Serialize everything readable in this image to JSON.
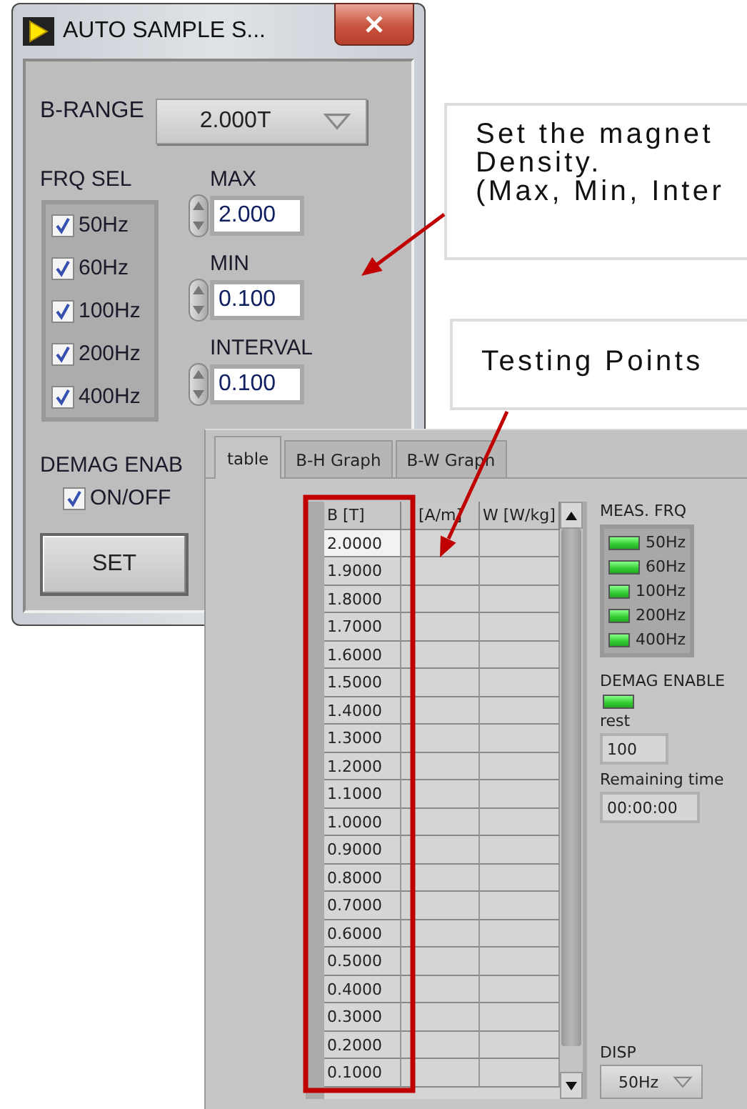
{
  "settings_window": {
    "title": "AUTO SAMPLE S...",
    "b_range": {
      "label": "B-RANGE",
      "value": "2.000T"
    },
    "frq_sel": {
      "label": "FRQ SEL",
      "options": [
        {
          "label": "50Hz",
          "checked": true
        },
        {
          "label": "60Hz",
          "checked": true
        },
        {
          "label": "100Hz",
          "checked": true
        },
        {
          "label": "200Hz",
          "checked": true
        },
        {
          "label": "400Hz",
          "checked": true
        }
      ]
    },
    "numerics": [
      {
        "label": "MAX",
        "value": "2.000"
      },
      {
        "label": "MIN",
        "value": "0.100"
      },
      {
        "label": "INTERVAL",
        "value": "0.100"
      }
    ],
    "demag": {
      "label": "DEMAG ENAB",
      "option": {
        "label": "ON/OFF",
        "checked": true
      }
    },
    "set_button": "SET"
  },
  "results_window": {
    "tabs": [
      {
        "label": "table",
        "selected": true
      },
      {
        "label": "B-H Graph",
        "selected": false
      },
      {
        "label": "B-W Graph",
        "selected": false
      }
    ],
    "table": {
      "columns": [
        "B [T]",
        "[A/m]",
        "W [W/kg]"
      ],
      "rows": [
        "2.0000",
        "1.9000",
        "1.8000",
        "1.7000",
        "1.6000",
        "1.5000",
        "1.4000",
        "1.3000",
        "1.2000",
        "1.1000",
        "1.0000",
        "0.9000",
        "0.8000",
        "0.7000",
        "0.6000",
        "0.5000",
        "0.4000",
        "0.3000",
        "0.2000",
        "0.1000"
      ]
    },
    "meas_frq": {
      "label": "MEAS. FRQ",
      "leds": [
        {
          "label": "50Hz",
          "on": true
        },
        {
          "label": "60Hz",
          "on": true
        },
        {
          "label": "100Hz",
          "on": true
        },
        {
          "label": "200Hz",
          "on": true
        },
        {
          "label": "400Hz",
          "on": true
        }
      ]
    },
    "demag_enable": {
      "label": "DEMAG ENABLE",
      "on": true
    },
    "rest": {
      "label": "rest",
      "value": "100"
    },
    "remaining_time": {
      "label": "Remaining time",
      "value": "00:00:00"
    },
    "disp": {
      "label": "DISP",
      "value": "50Hz"
    }
  },
  "callouts": [
    {
      "lines": [
        "Set the magnet",
        "Density.",
        "(Max, Min, Inter"
      ]
    },
    {
      "lines": [
        "Testing Points"
      ]
    }
  ]
}
